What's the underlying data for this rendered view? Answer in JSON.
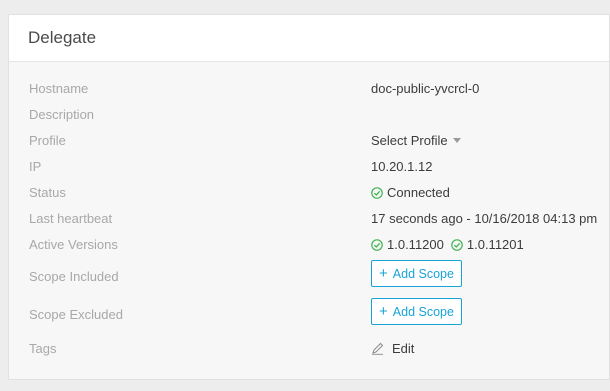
{
  "panel": {
    "title": "Delegate"
  },
  "fields": {
    "hostname": {
      "label": "Hostname",
      "value": "doc-public-yvcrcl-0"
    },
    "description": {
      "label": "Description",
      "value": ""
    },
    "profile": {
      "label": "Profile",
      "value": "Select Profile"
    },
    "ip": {
      "label": "IP",
      "value": "10.20.1.12"
    },
    "status": {
      "label": "Status",
      "value": "Connected",
      "color": "#3fb34f"
    },
    "last_heartbeat": {
      "label": "Last heartbeat",
      "value": "17 seconds ago - 10/16/2018 04:13 pm"
    },
    "active_versions": {
      "label": "Active Versions",
      "values": [
        "1.0.11200",
        "1.0.11201"
      ]
    },
    "scope_included": {
      "label": "Scope Included",
      "button": "Add Scope"
    },
    "scope_excluded": {
      "label": "Scope Excluded",
      "button": "Add Scope"
    },
    "tags": {
      "label": "Tags",
      "edit": "Edit"
    }
  },
  "colors": {
    "accent": "#1aa3d6",
    "success": "#3fb34f"
  },
  "icons": {
    "status": "check-circle-icon",
    "add": "plus-icon",
    "edit": "pencil-icon",
    "dropdown": "caret-down-icon"
  }
}
